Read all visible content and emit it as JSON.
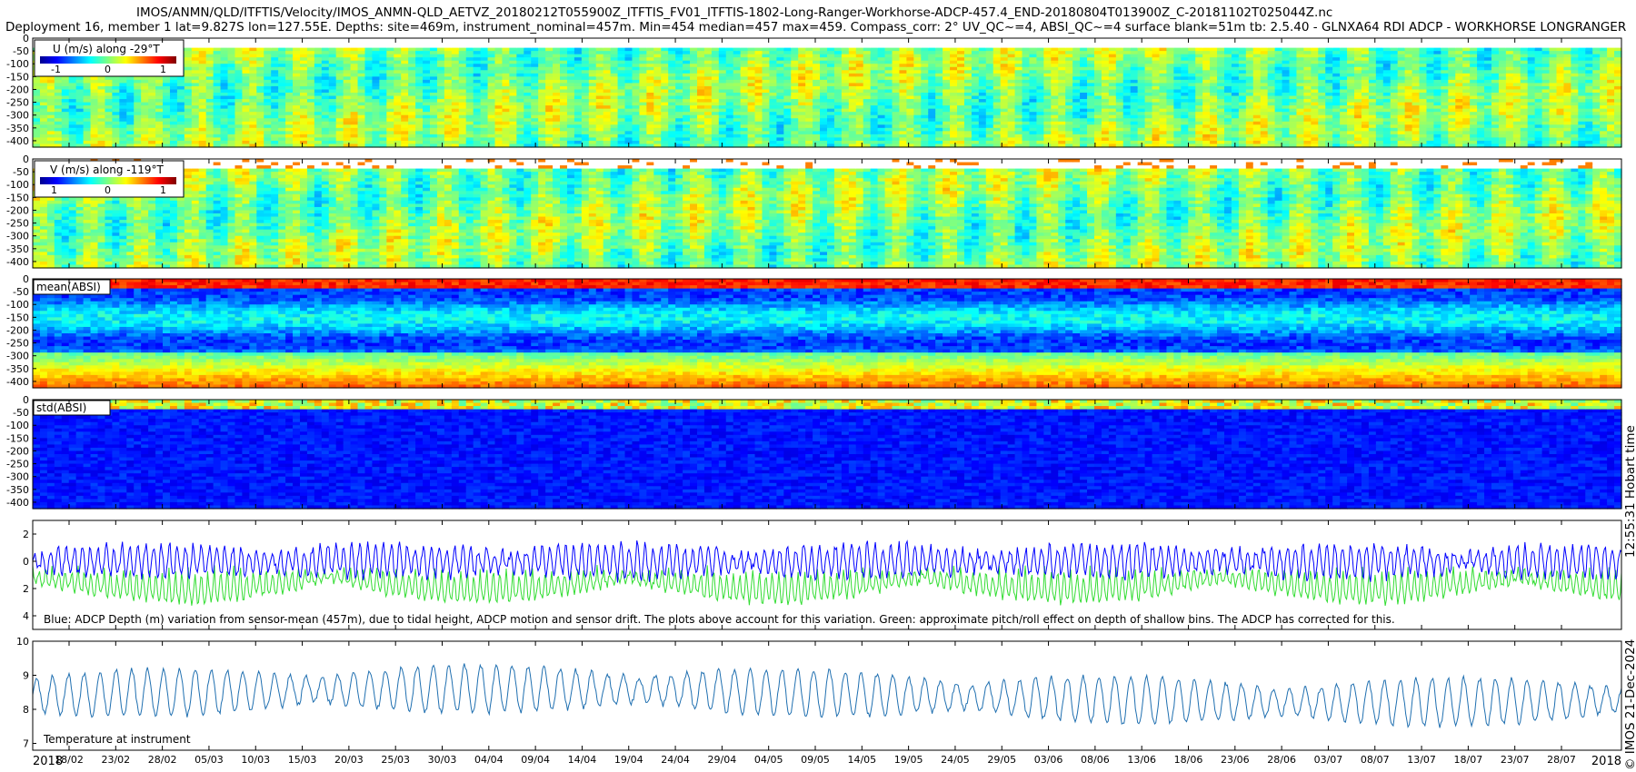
{
  "header": {
    "line1": "IMOS/ANMN/QLD/ITFTIS/Velocity/IMOS_ANMN-QLD_AETVZ_20180212T055900Z_ITFTIS_FV01_ITFTIS-1802-Long-Ranger-Workhorse-ADCP-457.4_END-20180804T013900Z_C-20181102T025044Z.nc",
    "line2": "Deployment 16, member 1 lat=9.827S lon=127.55E. Depths: site=469m, instrument_nominal=457m. Min=454 median=457 max=459. Compass_corr: 2° UV_QC~=4, ABSI_QC~=4 surface blank=51m tb: 2.5.40 - GLNXA64 RDI ADCP - WORKHORSE LONGRANGER"
  },
  "side_labels": {
    "hobart": "12:55:31 Hobart time",
    "imos": "© IMOS 21-Dec-2024"
  },
  "colors": {
    "jet_low": "#00008f",
    "jet_mid": "#30d040",
    "jet_high": "#a00000",
    "depth_line": "#0000ff",
    "pitch_line": "#33dd33",
    "temp_line": "#1f6fb0"
  },
  "chart_data": [
    {
      "type": "heatmap",
      "panel": "U",
      "legend_title": "U (m/s) along -29°T",
      "colorbar_ticks": [
        "-1",
        "0",
        "1"
      ],
      "yticks": [
        "0",
        "-50",
        "-100",
        "-150",
        "-200",
        "-250",
        "-300",
        "-350",
        "-400"
      ],
      "ylim": [
        -425,
        0
      ],
      "dominant_value": 0,
      "colormap": "jet"
    },
    {
      "type": "heatmap",
      "panel": "V",
      "legend_title": "V (m/s) along -119°T",
      "colorbar_ticks": [
        "1",
        "0",
        "1"
      ],
      "yticks": [
        "0",
        "-50",
        "-100",
        "-150",
        "-200",
        "-250",
        "-300",
        "-350",
        "-400"
      ],
      "ylim": [
        -425,
        0
      ],
      "dominant_value": 0,
      "colormap": "jet"
    },
    {
      "type": "heatmap",
      "panel": "mean_absi",
      "legend_title": "mean(ABSI)",
      "yticks": [
        "0",
        "-50",
        "-100",
        "-150",
        "-200",
        "-250",
        "-300",
        "-350",
        "-400"
      ],
      "ylim": [
        -425,
        0
      ],
      "colormap": "jet"
    },
    {
      "type": "heatmap",
      "panel": "std_absi",
      "legend_title": "std(ABSI)",
      "yticks": [
        "0",
        "-50",
        "-100",
        "-150",
        "-200",
        "-250",
        "-300",
        "-350",
        "-400"
      ],
      "ylim": [
        -425,
        0
      ],
      "colormap": "jet"
    },
    {
      "type": "line",
      "panel": "depth_variation",
      "annotation": "Blue: ADCP Depth (m) variation from sensor-mean (457m), due to tidal height, ADCP motion and sensor drift. The plots above account for this variation. Green: approximate pitch/roll effect on depth of shallow bins. The ADCP has corrected for this.",
      "yticks": [
        "2",
        "0",
        "2",
        "4"
      ],
      "ylim": [
        -5,
        3
      ],
      "series": [
        {
          "color": "#0000ff",
          "center": 0,
          "amplitude": 1.2
        },
        {
          "color": "#33dd33",
          "center": -0.5,
          "amplitude": 2.5
        }
      ]
    },
    {
      "type": "line",
      "panel": "temperature",
      "annotation": "Temperature at instrument",
      "yticks": [
        "10",
        "9",
        "8",
        "7"
      ],
      "ylim": [
        6.8,
        10
      ],
      "series": [
        {
          "color": "#1f6fb0",
          "mean": 8.4,
          "amplitude": 0.7
        }
      ]
    }
  ],
  "xaxis": {
    "year_left": "2018",
    "year_right": "2018",
    "ticks": [
      "18/02",
      "23/02",
      "28/02",
      "05/03",
      "10/03",
      "15/03",
      "20/03",
      "25/03",
      "30/03",
      "04/04",
      "09/04",
      "14/04",
      "19/04",
      "24/04",
      "29/04",
      "04/05",
      "09/05",
      "14/05",
      "19/05",
      "24/05",
      "29/05",
      "03/06",
      "08/06",
      "13/06",
      "18/06",
      "23/06",
      "28/06",
      "03/07",
      "08/07",
      "13/07",
      "18/07",
      "23/07",
      "28/07"
    ]
  }
}
